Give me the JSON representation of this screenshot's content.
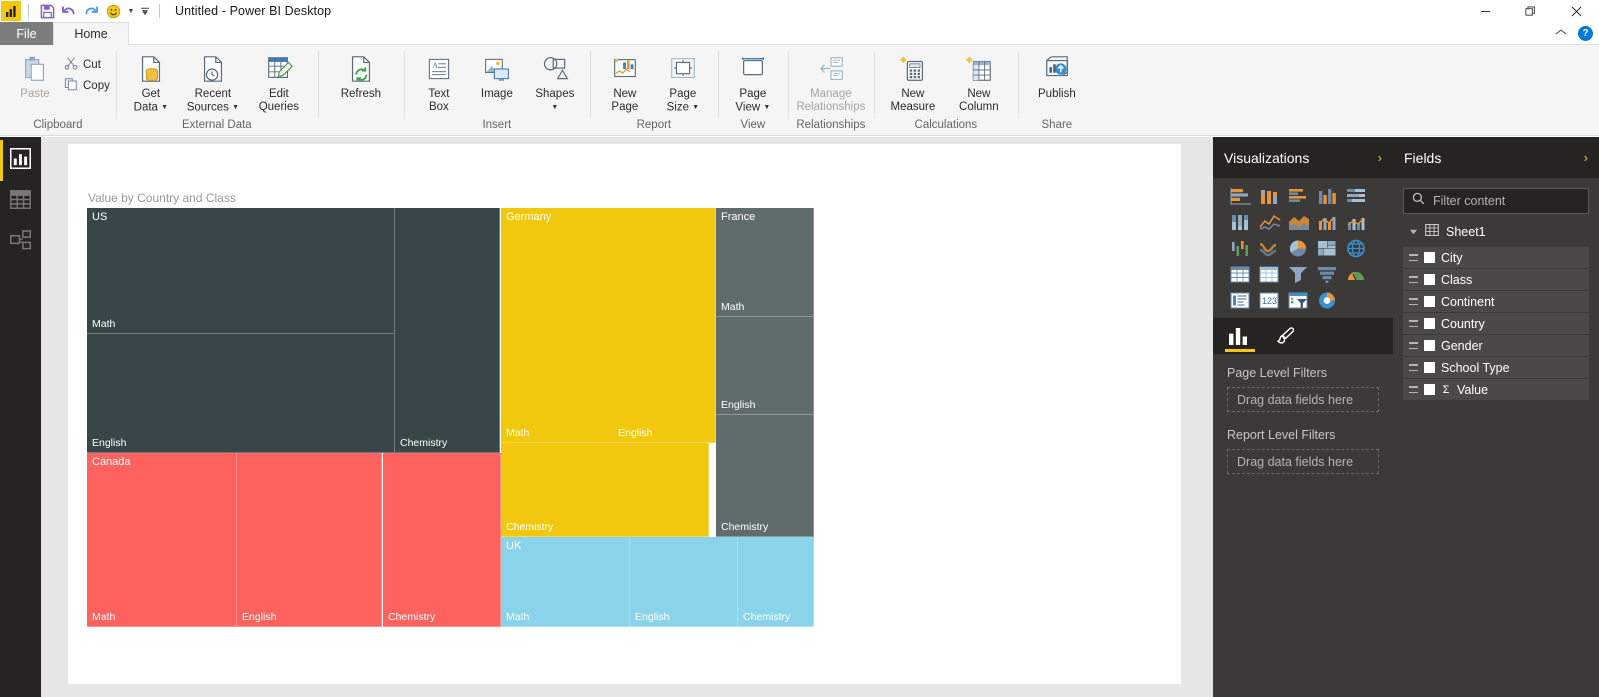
{
  "window": {
    "title": "Untitled - Power BI Desktop",
    "logo_icon": "power-bi-logo",
    "quick_access": [
      {
        "name": "save",
        "icon": "save-icon"
      },
      {
        "name": "undo",
        "icon": "undo-icon"
      },
      {
        "name": "redo",
        "icon": "redo-icon"
      },
      {
        "name": "smiley",
        "icon": "smiley-face-icon"
      }
    ],
    "controls": {
      "minimize": "—",
      "maximize": "maximize-icon",
      "close": "✕"
    }
  },
  "ribbon": {
    "tabs": [
      {
        "label": "File",
        "active": false
      },
      {
        "label": "Home",
        "active": true
      }
    ],
    "collapse_icon": "chevron-up-icon",
    "help_label": "?",
    "groups": [
      {
        "label": "Clipboard",
        "paste": {
          "label": "Paste",
          "icon": "paste-icon",
          "disabled": true
        },
        "small": [
          {
            "label": "Cut",
            "icon": "scissors-icon"
          },
          {
            "label": "Copy",
            "icon": "copy-icon"
          }
        ]
      },
      {
        "label": "External Data",
        "buttons": [
          {
            "label": "Get\nData",
            "line1": "Get",
            "line2": "Data",
            "icon": "get-data-icon",
            "caret": true
          },
          {
            "label": "Recent\nSources",
            "line1": "Recent",
            "line2": "Sources",
            "icon": "recent-sources-icon",
            "caret": true
          },
          {
            "label": "Edit\nQueries",
            "line1": "Edit",
            "line2": "Queries",
            "icon": "edit-queries-icon",
            "caret": false
          }
        ]
      },
      {
        "label": "Report",
        "refresh": {
          "line1": "Refresh",
          "line2": "",
          "icon": "refresh-icon"
        },
        "buttons": [
          {
            "line1": "New",
            "line2": "Page",
            "icon": "new-page-icon",
            "caret": false
          },
          {
            "line1": "Page",
            "line2": "Size",
            "icon": "page-size-icon",
            "caret": true
          }
        ]
      },
      {
        "label": "Insert",
        "buttons": [
          {
            "line1": "Text",
            "line2": "Box",
            "icon": "text-box-icon",
            "caret": false
          },
          {
            "line1": "Image",
            "line2": "",
            "icon": "image-icon",
            "caret": false
          },
          {
            "line1": "Shapes",
            "line2": "",
            "icon": "shapes-icon",
            "caret": true
          }
        ]
      },
      {
        "label": "View",
        "buttons": [
          {
            "line1": "Page",
            "line2": "View",
            "icon": "page-view-icon",
            "caret": true
          }
        ]
      },
      {
        "label": "Relationships",
        "buttons": [
          {
            "line1": "Manage",
            "line2": "Relationships",
            "icon": "manage-relationships-icon",
            "caret": false,
            "disabled": true
          }
        ]
      },
      {
        "label": "Calculations",
        "buttons": [
          {
            "line1": "New",
            "line2": "Measure",
            "icon": "new-measure-icon",
            "caret": false
          },
          {
            "line1": "New",
            "line2": "Column",
            "icon": "new-column-icon",
            "caret": false
          }
        ]
      },
      {
        "label": "Share",
        "buttons": [
          {
            "line1": "Publish",
            "line2": "",
            "icon": "publish-icon",
            "caret": false
          }
        ]
      }
    ]
  },
  "view_bar": {
    "items": [
      {
        "name": "report-view",
        "icon": "bar-chart-icon",
        "active": true
      },
      {
        "name": "data-view",
        "icon": "table-grid-icon",
        "active": false
      },
      {
        "name": "relationships-view",
        "icon": "relationships-icon",
        "active": false
      }
    ]
  },
  "visual": {
    "title": "Value by Country and Class"
  },
  "chart_data": {
    "type": "treemap",
    "title": "Value by Country and Class",
    "group_field": "Country",
    "detail_field": "Class",
    "value_field": "Value",
    "legend": "none",
    "colors": {
      "US": "#374649",
      "Canada": "#FD625E",
      "Germany": "#F2C80F",
      "France": "#5F6B6D",
      "UK": "#8AD4EB"
    },
    "groups": [
      {
        "country": "US",
        "color": "#374649",
        "tiles": [
          {
            "class": "Math",
            "rect": [
              0,
              0,
              0.424,
              0.3
            ]
          },
          {
            "class": "English",
            "rect": [
              0,
              0.3,
              0.424,
              0.284
            ]
          },
          {
            "class": "Chemistry",
            "rect": [
              0.424,
              0,
              0.145,
              0.584
            ]
          }
        ]
      },
      {
        "country": "Canada",
        "color": "#FD625E",
        "tiles": [
          {
            "class": "Math",
            "rect": [
              0,
              0.584,
              0.207,
              0.416
            ]
          },
          {
            "class": "English",
            "rect": [
              0.207,
              0.584,
              0.2,
              0.416
            ]
          },
          {
            "class": "Chemistry",
            "rect": [
              0.407,
              0.584,
              0.162,
              0.416
            ]
          }
        ]
      },
      {
        "country": "Germany",
        "color": "#F2C80F",
        "tiles": [
          {
            "class": "Math",
            "rect": [
              0.569,
              0,
              0.155,
              0.56
            ]
          },
          {
            "class": "English",
            "rect": [
              0.724,
              0,
              0.141,
              0.56
            ]
          },
          {
            "class": "Chemistry",
            "rect": [
              0.569,
              0.56,
              0.286,
              0.225
            ]
          }
        ]
      },
      {
        "country": "France",
        "color": "#5F6B6D",
        "tiles": [
          {
            "class": "Math",
            "rect": [
              0.865,
              0,
              0.135,
              0.26
            ]
          },
          {
            "class": "English",
            "rect": [
              0.865,
              0.26,
              0.135,
              0.235
            ]
          },
          {
            "class": "Chemistry",
            "rect": [
              0.865,
              0.495,
              0.135,
              0.29
            ]
          }
        ]
      },
      {
        "country": "UK",
        "color": "#8AD4EB",
        "tiles": [
          {
            "class": "Math",
            "rect": [
              0.569,
              0.785,
              0.178,
              0.215
            ]
          },
          {
            "class": "English",
            "rect": [
              0.747,
              0.785,
              0.148,
              0.215
            ]
          },
          {
            "class": "Chemistry",
            "rect": [
              0.895,
              0.785,
              0.105,
              0.215
            ]
          }
        ]
      }
    ]
  },
  "visualizations": {
    "title": "Visualizations",
    "expand_icon": "chevron-right-icon",
    "icons": [
      "stacked-bar-chart",
      "stacked-column-chart",
      "clustered-bar-chart",
      "clustered-column-chart",
      "100-stacked-bar-chart",
      "100-stacked-column-chart",
      "line-chart",
      "area-chart",
      "stacked-area-chart",
      "line-stacked-column-chart",
      "line-clustered-column-chart",
      "ribbon-chart",
      "pie-chart",
      "treemap",
      "map",
      "matrix",
      "table",
      "funnel-alt",
      "funnel-chart",
      "gauge-chart",
      "card",
      "multi-row-card",
      "slicer",
      "donut-chart"
    ],
    "tabs": [
      {
        "name": "fields-tab",
        "icon": "bar-chart-icon",
        "active": true
      },
      {
        "name": "format-tab",
        "icon": "paintbrush-icon",
        "active": false
      }
    ],
    "filters": [
      {
        "label": "Page Level Filters",
        "dropzone": "Drag data fields here"
      },
      {
        "label": "Report Level Filters",
        "dropzone": "Drag data fields here"
      }
    ]
  },
  "fields": {
    "title": "Fields",
    "expand_icon": "chevron-right-icon",
    "search": {
      "placeholder": "Filter content",
      "icon": "search-icon",
      "value": ""
    },
    "table": {
      "name": "Sheet1",
      "icon": "table-icon",
      "expanded": true
    },
    "items": [
      {
        "label": "City",
        "aggregate": false
      },
      {
        "label": "Class",
        "aggregate": false
      },
      {
        "label": "Continent",
        "aggregate": false
      },
      {
        "label": "Country",
        "aggregate": false
      },
      {
        "label": "Gender",
        "aggregate": false
      },
      {
        "label": "School Type",
        "aggregate": false
      },
      {
        "label": "Value",
        "aggregate": true,
        "aggregate_symbol": "Σ"
      }
    ]
  }
}
